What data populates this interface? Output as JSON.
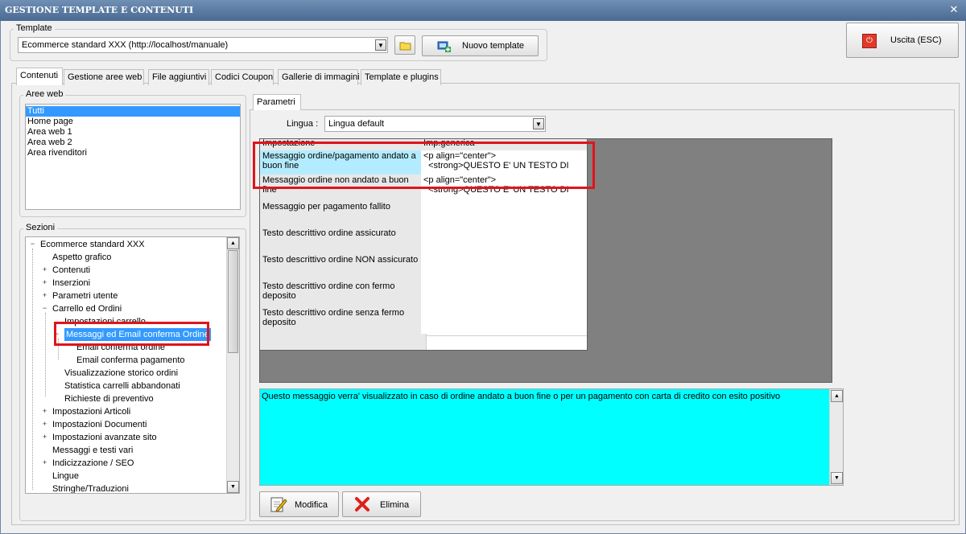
{
  "window": {
    "title": "GESTIONE TEMPLATE E CONTENUTI",
    "close_glyph": "✕"
  },
  "template_group": {
    "label": "Template",
    "combo_value": "Ecommerce standard XXX (http://localhost/manuale)",
    "new_template_label": "Nuovo template"
  },
  "exit_button": {
    "label": "Uscita (ESC)"
  },
  "tabs": [
    {
      "label": "Contenuti"
    },
    {
      "label": "Gestione aree web"
    },
    {
      "label": "File aggiuntivi"
    },
    {
      "label": "Codici Coupon"
    },
    {
      "label": "Gallerie di immagini"
    },
    {
      "label": "Template e plugins"
    }
  ],
  "aree_web": {
    "label": "Aree web",
    "items": [
      "Tutti",
      "Home page",
      "Area web 1",
      "Area web 2",
      "Area rivenditori"
    ]
  },
  "sezioni": {
    "label": "Sezioni",
    "nodes": [
      {
        "text": "Ecommerce standard XXX",
        "exp": "−"
      },
      {
        "text": "Aspetto grafico",
        "exp": ""
      },
      {
        "text": "Contenuti",
        "exp": "+"
      },
      {
        "text": "Inserzioni",
        "exp": "+"
      },
      {
        "text": "Parametri utente",
        "exp": "+"
      },
      {
        "text": "Carrello ed Ordini",
        "exp": "−"
      },
      {
        "text": "Impostazioni carrello",
        "exp": ""
      },
      {
        "text": "Messaggi ed Email conferma Ordine",
        "exp": "−"
      },
      {
        "text": "Email conferma ordine",
        "exp": ""
      },
      {
        "text": "Email conferma pagamento",
        "exp": ""
      },
      {
        "text": "Visualizzazione storico ordini",
        "exp": ""
      },
      {
        "text": "Statistica carrelli abbandonati",
        "exp": ""
      },
      {
        "text": "Richieste di preventivo",
        "exp": ""
      },
      {
        "text": "Impostazioni Articoli",
        "exp": "+"
      },
      {
        "text": "Impostazioni Documenti",
        "exp": "+"
      },
      {
        "text": "Impostazioni avanzate sito",
        "exp": "+"
      },
      {
        "text": "Messaggi e testi vari",
        "exp": ""
      },
      {
        "text": "Indicizzazione / SEO",
        "exp": "+"
      },
      {
        "text": "Lingue",
        "exp": ""
      },
      {
        "text": "Stringhe/Traduzioni",
        "exp": ""
      }
    ]
  },
  "parametri": {
    "tab_label": "Parametri",
    "lingua_label": "Lingua :",
    "lingua_value": "Lingua default",
    "grid": {
      "headers": [
        "Impostazione",
        "Imp.generica"
      ],
      "rows": [
        {
          "name": "Messaggio ordine/pagamento andato a buon fine",
          "value": "<p align=\"center\">\n  <strong>QUESTO E' UN TESTO DI"
        },
        {
          "name": "Messaggio ordine non andato a buon fine",
          "value": "<p align=\"center\">\n  <strong>QUESTO E' UN TESTO DI"
        },
        {
          "name": "Messaggio per pagamento fallito",
          "value": ""
        },
        {
          "name": "Testo descrittivo ordine assicurato",
          "value": ""
        },
        {
          "name": "Testo descrittivo ordine NON assicurato",
          "value": ""
        },
        {
          "name": "Testo descrittivo ordine con fermo deposito",
          "value": ""
        },
        {
          "name": "Testo descrittivo ordine senza fermo deposito",
          "value": ""
        }
      ]
    },
    "description": "Questo messaggio verra' visualizzato in caso di ordine andato a buon fine o per un pagamento con carta di credito con esito positivo",
    "modifica_label": "Modifica",
    "elimina_label": "Elimina"
  },
  "colors": {
    "selected_cell": "#b4ecff",
    "description_bg": "#00ffff",
    "highlight": "#e0141b",
    "grid_bg": "#808080"
  }
}
